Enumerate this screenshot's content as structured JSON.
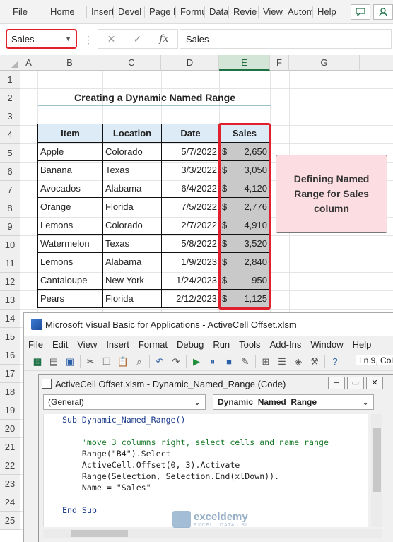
{
  "ribbon": {
    "tabs": [
      "File",
      "Home",
      "Insert",
      "Devel",
      "Page I",
      "Formu",
      "Data",
      "Revie",
      "View",
      "Autom",
      "Help"
    ]
  },
  "formula_bar": {
    "name_box": "Sales",
    "formula": "Sales"
  },
  "grid": {
    "columns": [
      "A",
      "B",
      "C",
      "D",
      "E",
      "F",
      "G"
    ],
    "rows": [
      "1",
      "2",
      "3",
      "4",
      "5",
      "6",
      "7",
      "8",
      "9",
      "10",
      "11",
      "12",
      "13",
      "14",
      "15",
      "16",
      "17",
      "18",
      "19",
      "20",
      "21",
      "22",
      "23",
      "24",
      "25"
    ],
    "selected_column": "E"
  },
  "sheet": {
    "title": "Creating a Dynamic Named Range",
    "headers": [
      "Item",
      "Location",
      "Date",
      "Sales"
    ],
    "rows": [
      {
        "item": "Apple",
        "location": "Colorado",
        "date": "5/7/2022",
        "sales": "2,650"
      },
      {
        "item": "Banana",
        "location": "Texas",
        "date": "3/3/2022",
        "sales": "3,050"
      },
      {
        "item": "Avocados",
        "location": "Alabama",
        "date": "6/4/2022",
        "sales": "4,120"
      },
      {
        "item": "Orange",
        "location": "Florida",
        "date": "7/5/2022",
        "sales": "2,776"
      },
      {
        "item": "Lemons",
        "location": "Colorado",
        "date": "2/7/2022",
        "sales": "4,910"
      },
      {
        "item": "Watermelon",
        "location": "Texas",
        "date": "5/8/2022",
        "sales": "3,520"
      },
      {
        "item": "Lemons",
        "location": "Alabama",
        "date": "1/9/2023",
        "sales": "2,840"
      },
      {
        "item": "Cantaloupe",
        "location": "New York",
        "date": "1/24/2023",
        "sales": "950"
      },
      {
        "item": "Pears",
        "location": "Florida",
        "date": "2/12/2023",
        "sales": "1,125"
      }
    ],
    "currency": "$",
    "note": "Defining Named Range for Sales column"
  },
  "vba": {
    "title": "Microsoft Visual Basic for Applications - ActiveCell Offset.xlsm",
    "menu": [
      "File",
      "Edit",
      "View",
      "Insert",
      "Format",
      "Debug",
      "Run",
      "Tools",
      "Add-Ins",
      "Window",
      "Help"
    ],
    "status": "Ln 9, Col",
    "code_window_title": "ActiveCell Offset.xlsm - Dynamic_Named_Range (Code)",
    "object_dropdown": "(General)",
    "proc_dropdown": "Dynamic_Named_Range",
    "code": {
      "line1": "Sub Dynamic_Named_Range()",
      "line2": "'move 3 columns right, select cells and name range",
      "line3": "Range(\"B4\").Select",
      "line4": "ActiveCell.Offset(0, 3).Activate",
      "line5": "Range(Selection, Selection.End(xlDown)). _",
      "line6": "Name = \"Sales\"",
      "line7": "End Sub"
    }
  },
  "watermark": {
    "name": "exceldemy",
    "tagline": "EXCEL · DATA · BI"
  },
  "colors": {
    "highlight_red": "#e0202c",
    "header_fill": "#ddebf7",
    "sales_fill": "#c9c9c9",
    "note_fill": "#fbdde2"
  }
}
